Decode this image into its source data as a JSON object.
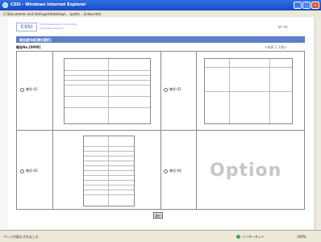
{
  "window": {
    "title": "CSSI - Windows Internet Explorer",
    "address": "C:\\Documents and Settings\\tl\\desktop\\... (path) ...\\index.htm"
  },
  "page": {
    "brand": "CSSI",
    "brand_sub1": "The Professional of Computing",
    "brand_sub2": "Information Service",
    "top_right": "ﾛｸﾞｱｳﾄ",
    "header": "報告書作成[様式選択]",
    "sub_label": "報告No.[0000]",
    "pager": "<前頁 1 /2頁>",
    "select_button": "選択"
  },
  "cells": [
    {
      "label": "様式-01"
    },
    {
      "label": "様式-02"
    },
    {
      "label": "様式-03"
    },
    {
      "label": "様式-04",
      "placeholder_text": "Option"
    }
  ],
  "statusbar": {
    "left": "ページが表示されました",
    "middle": "インターネット",
    "zoom": "100%"
  }
}
